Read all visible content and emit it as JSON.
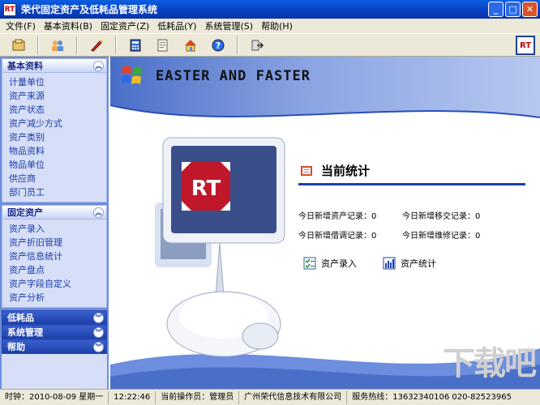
{
  "window": {
    "title": "荣代固定资产及低耗品管理系统",
    "icon_text": "RT",
    "controls": [
      "_",
      "□",
      "✕"
    ]
  },
  "menu": [
    "文件(F)",
    "基本资料(B)",
    "固定资产(Z)",
    "低耗品(Y)",
    "系统管理(S)",
    "帮助(H)"
  ],
  "toolbar": {
    "buttons": [
      "asset-icon",
      "users-icon",
      "pen-icon",
      "calculator-icon",
      "book-icon",
      "home-icon",
      "help-icon",
      "exit-icon"
    ],
    "logo": "RT"
  },
  "sidebar": {
    "sections": [
      {
        "title": "基本资料",
        "expanded": true,
        "items": [
          "计量单位",
          "资产来源",
          "资产状态",
          "资产减少方式",
          "资产类别",
          "物品资料",
          "物品单位",
          "供应商",
          "部门员工"
        ]
      },
      {
        "title": "固定资产",
        "expanded": true,
        "items": [
          "资产录入",
          "资产折旧管理",
          "资产信息统计",
          "资产盘点",
          "资产字段自定义",
          "资产分析"
        ]
      },
      {
        "title": "低耗品",
        "expanded": false,
        "items": []
      },
      {
        "title": "系统管理",
        "expanded": false,
        "items": []
      },
      {
        "title": "帮助",
        "expanded": false,
        "items": []
      }
    ]
  },
  "main": {
    "banner_title": "EASTER AND FASTER",
    "stats_title": "当前统计",
    "stats": {
      "new_assets": "今日新增资产记录：0",
      "new_transfers": "今日新增移交记录：0",
      "new_borrows": "今日新增借调记录：0",
      "new_repairs": "今日新增维修记录：0"
    },
    "actions": {
      "asset_entry": "资产录入",
      "asset_stats": "资产统计"
    },
    "imac_label": "RT",
    "watermark": "下载吧"
  },
  "status": {
    "date": "时钟：2010-08-09  星期一",
    "time": "12:22:46",
    "operator": "当前操作员：管理员",
    "company": "广州荣代信息技术有限公司",
    "hotline": "服务热线：13632340106  020-82523965"
  },
  "colors": {
    "titlebar": "#0a3fc0",
    "sidebar_bg": "#6d8dde",
    "link": "#1a3aa6"
  }
}
